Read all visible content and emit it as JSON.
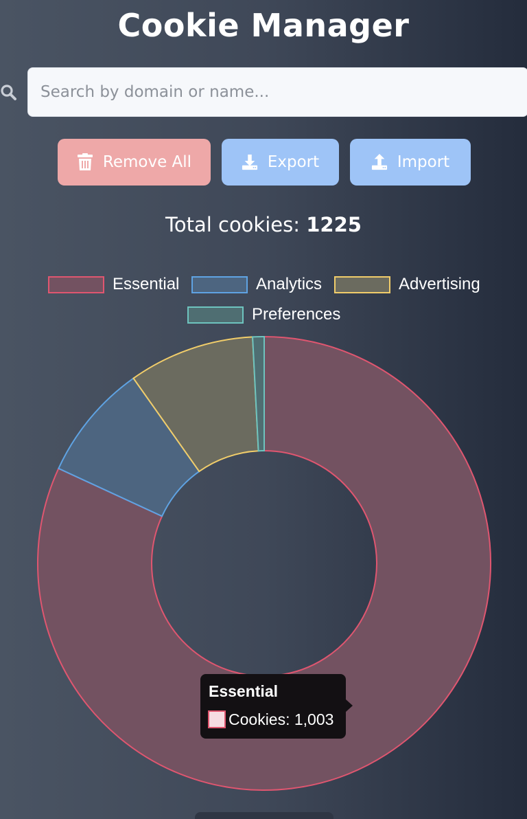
{
  "title": "Cookie Manager",
  "search": {
    "placeholder": "Search by domain or name..."
  },
  "actions": {
    "remove_all": "Remove All",
    "export": "Export",
    "import": "Import"
  },
  "total": {
    "label": "Total cookies: ",
    "value": "1225"
  },
  "icons": [
    "search-icon",
    "trash-icon",
    "download-icon",
    "upload-icon"
  ],
  "colors": {
    "remove_button": "#eea8a8",
    "action_button": "#9ec4f7",
    "tooltip_bg": "#131013"
  },
  "chart_data": {
    "type": "doughnut",
    "total": 1225,
    "legend_position": "top",
    "categories": [
      "Essential",
      "Analytics",
      "Advertising",
      "Preferences"
    ],
    "values": [
      1003,
      102,
      110,
      10
    ],
    "colors": {
      "Essential": {
        "border": "#e05670",
        "fill": "#735261"
      },
      "Analytics": {
        "border": "#5fa3e3",
        "fill": "#4d6580"
      },
      "Advertising": {
        "border": "#f1cd6a",
        "fill": "#6b6b5f"
      },
      "Preferences": {
        "border": "#6ec4bf",
        "fill": "#4f6e72"
      }
    },
    "tooltip": {
      "title": "Essential",
      "label": "Cookies: 1,003"
    }
  }
}
